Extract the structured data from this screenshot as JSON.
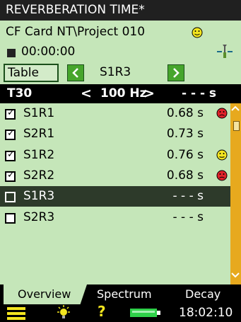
{
  "title": "REVERBERATION TIME*",
  "status": {
    "path": "CF  Card NT\\Project 010",
    "timer": "00:00:00"
  },
  "nav": {
    "view_label": "Table",
    "position_label": "S1R3"
  },
  "param": {
    "name": "T30",
    "frequency": "100 Hz",
    "value": "- - -  s",
    "prev_glyph": "<",
    "next_glyph": ">"
  },
  "rows": [
    {
      "name": "S1R1",
      "value": "0.68 s",
      "checked": true,
      "indicator": "red-sad"
    },
    {
      "name": "S2R1",
      "value": "0.73 s",
      "checked": true,
      "indicator": "none"
    },
    {
      "name": "S1R2",
      "value": "0.76 s",
      "checked": true,
      "indicator": "yellow-neutral"
    },
    {
      "name": "S2R2",
      "value": "0.68 s",
      "checked": true,
      "indicator": "red-sad"
    },
    {
      "name": "S1R3",
      "value": "- - -  s",
      "checked": false,
      "indicator": "none",
      "selected": true
    },
    {
      "name": "S2R3",
      "value": "- - -  s",
      "checked": false,
      "indicator": "none"
    }
  ],
  "tabs": {
    "overview": "Overview",
    "spectrum": "Spectrum",
    "decay": "Decay"
  },
  "clock": "18:02:10",
  "help_glyph": "?",
  "colors": {
    "panel_green": "#c5e6b9",
    "accent_green": "#46a52c",
    "scrollbar_orange": "#e7a91e",
    "smiley_red": "#e0222a",
    "smiley_yellow": "#f3e51f"
  }
}
